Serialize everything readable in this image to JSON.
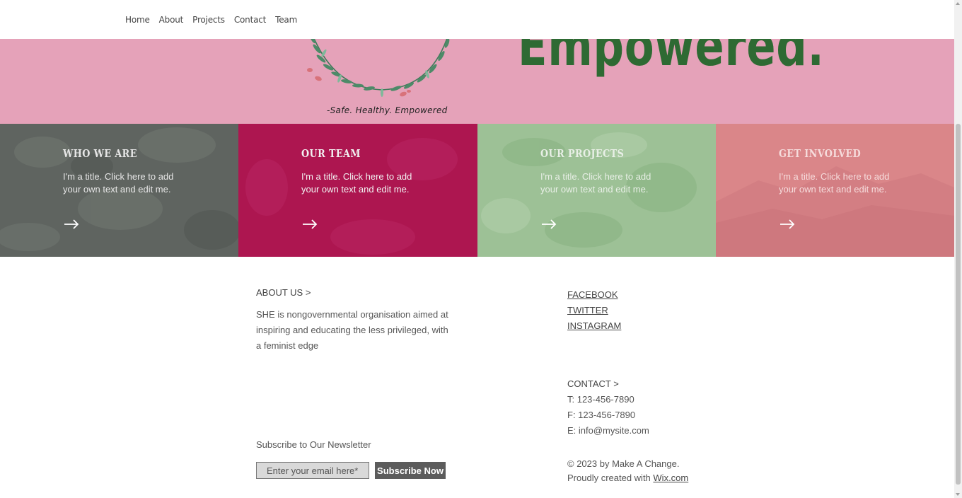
{
  "nav": {
    "items": [
      "Home",
      "About",
      "Projects",
      "Contact",
      "Team"
    ]
  },
  "hero": {
    "headline": "Empowered.",
    "tagline": "-Safe. Healthy. Empowered",
    "bg_color": "#e5a2b9",
    "headline_color": "#2e6a33"
  },
  "tiles": [
    {
      "title": "WHO WE ARE",
      "text": "I'm a title. Click here to add your own text and edit me.",
      "color": "#5f6460",
      "text_color": "#e6e6e6"
    },
    {
      "title": "OUR TEAM",
      "text": "I'm a title. Click here to add your own text and edit me.",
      "color": "#ad1650",
      "text_color": "#f2f2f2"
    },
    {
      "title": "OUR PROJECTS",
      "text": "I'm a title. Click here to add your own text and edit me.",
      "color": "#9dc196",
      "text_color": "#e8efe6"
    },
    {
      "title": "GET INVOLVED",
      "text": "I'm a title. Click here to add your own text and edit me.",
      "color": "#da8689",
      "text_color": "#f6dcdc"
    }
  ],
  "footer": {
    "about_title": "ABOUT US >",
    "about_text": "SHE is nongovernmental organisation aimed at inspiring and educating the less privileged, with a feminist edge",
    "social": [
      "FACEBOOK",
      "TWITTER",
      "INSTAGRAM"
    ],
    "contact_title": "CONTACT >",
    "contact": [
      "T: 123-456-7890",
      "F: 123-456-7890",
      "E: info@mysite.com"
    ],
    "newsletter_title": "Subscribe to Our Newsletter",
    "email_placeholder": "Enter your email here*",
    "subscribe_label": "Subscribe Now",
    "copyright": "© 2023 by Make A Change.",
    "created_prefix": "Proudly created with ",
    "created_link": "Wix.com"
  }
}
